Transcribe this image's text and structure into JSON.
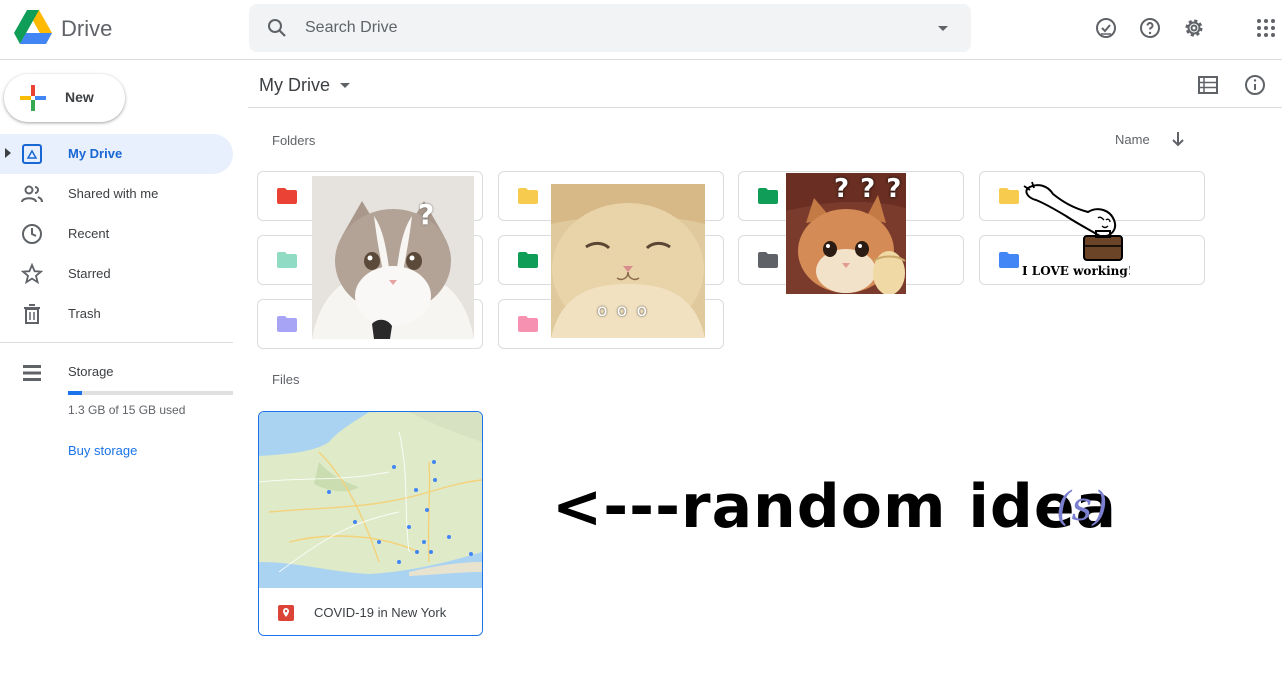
{
  "header": {
    "app_name": "Drive",
    "search_placeholder": "Search Drive",
    "icons": [
      "search-icon",
      "search-options-icon",
      "ready-for-offline-icon",
      "help-icon",
      "settings-icon",
      "apps-grid-icon"
    ]
  },
  "sidebar": {
    "new_label": "New",
    "items": [
      {
        "label": "My Drive",
        "icon": "my-drive-icon",
        "active": true
      },
      {
        "label": "Shared with me",
        "icon": "shared-icon",
        "active": false
      },
      {
        "label": "Recent",
        "icon": "clock-icon",
        "active": false
      },
      {
        "label": "Starred",
        "icon": "star-icon",
        "active": false
      },
      {
        "label": "Trash",
        "icon": "trash-icon",
        "active": false
      }
    ],
    "storage": {
      "label": "Storage",
      "used_text": "1.3 GB of 15 GB used",
      "used_fraction": 0.087,
      "buy_label": "Buy storage"
    }
  },
  "main": {
    "title": "My Drive",
    "folders_label": "Folders",
    "files_label": "Files",
    "sort_label": "Name",
    "folders": [
      {
        "color": "#ea4335"
      },
      {
        "color": "#f7cb4d"
      },
      {
        "color": "#0f9d58"
      },
      {
        "color": "#f7cb4d"
      },
      {
        "color": "#8fdbc3"
      },
      {
        "color": "#0f9d58"
      },
      {
        "color": "#5f6368"
      },
      {
        "color": "#4285f4"
      },
      {
        "color": "#a7a4f6"
      },
      {
        "color": "#f691b2"
      }
    ],
    "files": [
      {
        "name": "COVID-19 in New York",
        "icon": "map-pin-icon",
        "icon_color": "#db4437"
      }
    ]
  },
  "overlay": {
    "sticker_question": "?",
    "sticker_qqq": "? ? ?",
    "sticker_dots": "o o o",
    "sticker_working": "I LOVE working!",
    "caption": "<---random idea",
    "caption_suffix": "(s)"
  },
  "colors": {
    "accent": "#1a73e8",
    "active_bg": "#e8f0fe",
    "active_text": "#1967d2"
  }
}
